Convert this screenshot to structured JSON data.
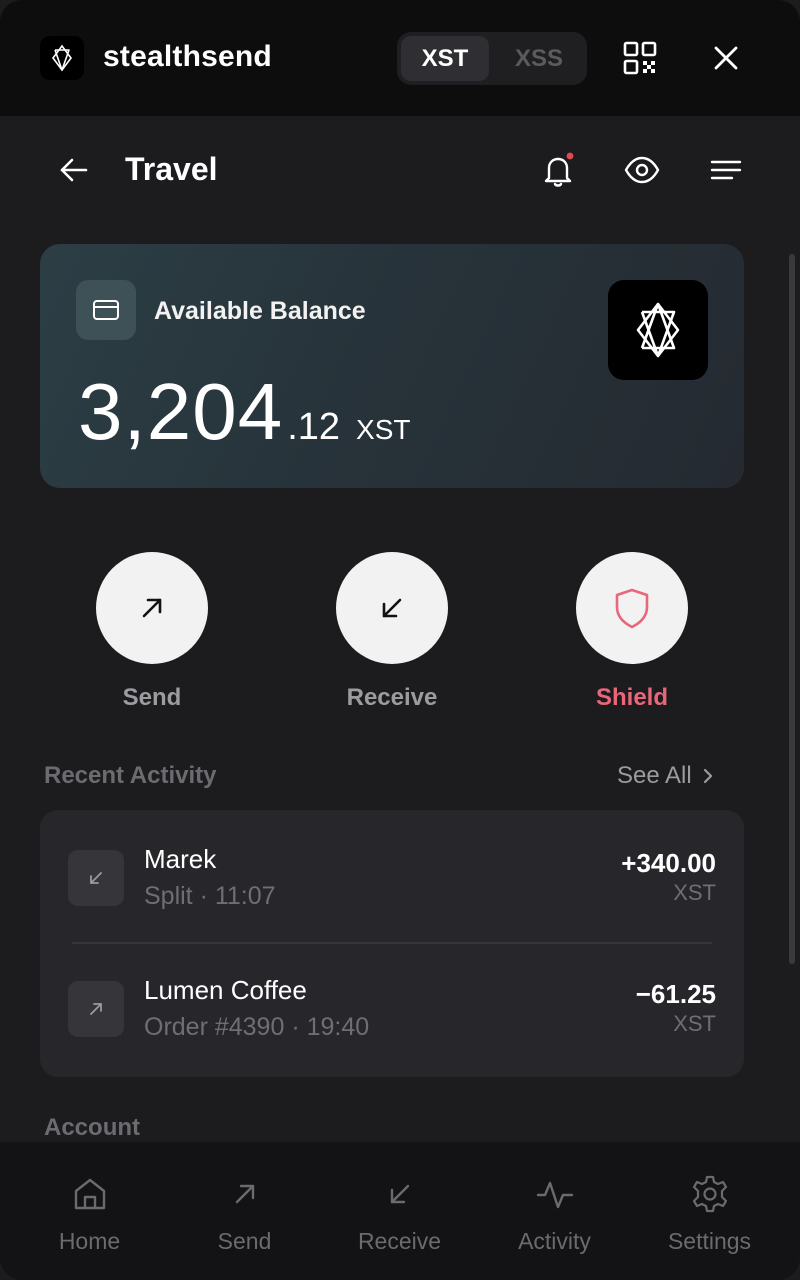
{
  "app": {
    "name": "stealthsend",
    "currency_tabs": [
      {
        "label": "XST",
        "active": true
      },
      {
        "label": "XSS",
        "active": false
      }
    ],
    "icons": {
      "qr": "qr-code-icon",
      "close": "close-icon"
    }
  },
  "header": {
    "title": "Travel",
    "icons": {
      "back": "arrow-left-icon",
      "bell": "bell-icon",
      "eye": "eye-icon",
      "menu": "menu-icon"
    },
    "notification_dot_color": "#e5484d"
  },
  "balance": {
    "label": "Available Balance",
    "integer": "3,204",
    "decimal": ".12",
    "currency": "XST"
  },
  "actions": [
    {
      "label": "Send",
      "icon": "arrow-up-right-icon"
    },
    {
      "label": "Receive",
      "icon": "arrow-down-left-icon"
    },
    {
      "label": "Shield",
      "icon": "shield-icon",
      "color": "#e8677a"
    }
  ],
  "recent_activity": {
    "title": "Recent Activity",
    "see_all": "See All",
    "items": [
      {
        "name": "Marek",
        "detail": "Split · 11:07",
        "amount": "+340.00",
        "currency": "XST",
        "icon": "arrow-down-left-icon"
      },
      {
        "name": "Lumen Coffee",
        "detail": "Order #4390 · 19:40",
        "amount": "−61.25",
        "currency": "XST",
        "icon": "arrow-up-right-icon"
      }
    ]
  },
  "account": {
    "title": "Account"
  },
  "bottom_nav": [
    {
      "label": "Home",
      "icon": "home-icon"
    },
    {
      "label": "Send",
      "icon": "arrow-up-right-icon"
    },
    {
      "label": "Receive",
      "icon": "arrow-down-left-icon"
    },
    {
      "label": "Activity",
      "icon": "activity-icon"
    },
    {
      "label": "Settings",
      "icon": "gear-icon"
    }
  ]
}
